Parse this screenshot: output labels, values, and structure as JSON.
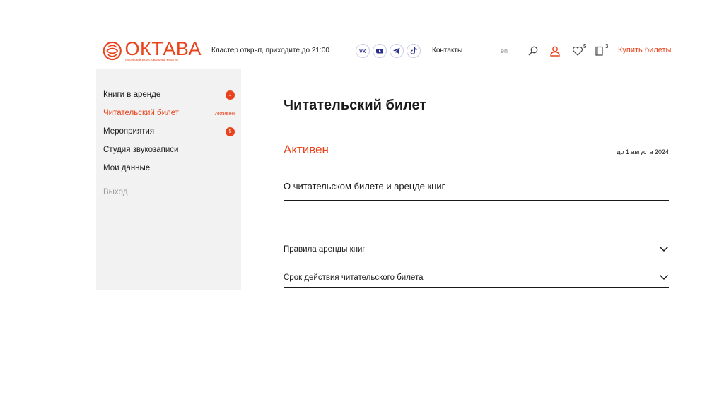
{
  "header": {
    "logo_text": "ОКТАВА",
    "logo_tagline": "творческий индустриальный кластер",
    "status_text": "Кластер открыт, приходите до 21:00",
    "socials": [
      {
        "name": "vk-icon",
        "label": "VK"
      },
      {
        "name": "youtube-icon"
      },
      {
        "name": "telegram-icon"
      },
      {
        "name": "tiktok-icon"
      }
    ],
    "contacts_label": "Контакты",
    "lang_label": "en",
    "favorites_count": "5",
    "books_count": "3",
    "buy_label": "Купить билеты",
    "colors": {
      "accent": "#e8431c",
      "social_icon": "#2b2f8c"
    }
  },
  "sidebar": {
    "items": [
      {
        "label": "Книги в аренде",
        "badge": "1"
      },
      {
        "label": "Читательский билет",
        "status": "Активен"
      },
      {
        "label": "Мероприятия",
        "badge": "5"
      },
      {
        "label": "Студия звукозаписи"
      },
      {
        "label": "Мои данные"
      }
    ],
    "logout_label": "Выход"
  },
  "main": {
    "title": "Читательский билет",
    "status": "Активен",
    "valid_until": "до 1 августа 2024",
    "section_title": "О читательском билете и аренде книг",
    "accordion": [
      {
        "label": "Правила аренды книг"
      },
      {
        "label": "Срок действия читательского билета"
      }
    ]
  }
}
